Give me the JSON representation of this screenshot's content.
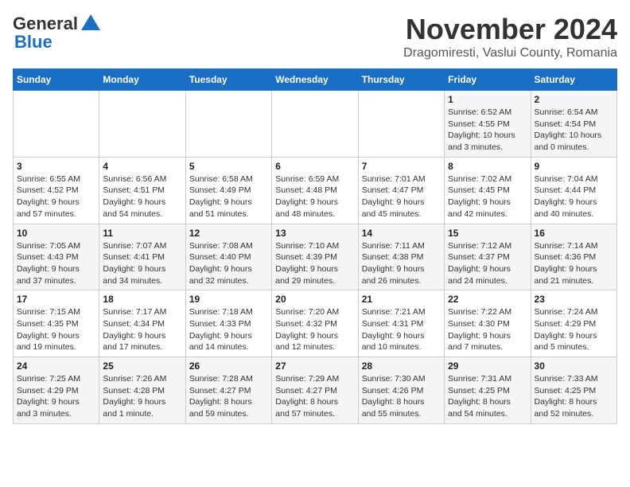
{
  "header": {
    "logo_line1": "General",
    "logo_line2": "Blue",
    "title": "November 2024",
    "subtitle": "Dragomiresti, Vaslui County, Romania"
  },
  "calendar": {
    "days_of_week": [
      "Sunday",
      "Monday",
      "Tuesday",
      "Wednesday",
      "Thursday",
      "Friday",
      "Saturday"
    ],
    "weeks": [
      [
        {
          "day": "",
          "info": ""
        },
        {
          "day": "",
          "info": ""
        },
        {
          "day": "",
          "info": ""
        },
        {
          "day": "",
          "info": ""
        },
        {
          "day": "",
          "info": ""
        },
        {
          "day": "1",
          "info": "Sunrise: 6:52 AM\nSunset: 4:55 PM\nDaylight: 10 hours\nand 3 minutes."
        },
        {
          "day": "2",
          "info": "Sunrise: 6:54 AM\nSunset: 4:54 PM\nDaylight: 10 hours\nand 0 minutes."
        }
      ],
      [
        {
          "day": "3",
          "info": "Sunrise: 6:55 AM\nSunset: 4:52 PM\nDaylight: 9 hours\nand 57 minutes."
        },
        {
          "day": "4",
          "info": "Sunrise: 6:56 AM\nSunset: 4:51 PM\nDaylight: 9 hours\nand 54 minutes."
        },
        {
          "day": "5",
          "info": "Sunrise: 6:58 AM\nSunset: 4:49 PM\nDaylight: 9 hours\nand 51 minutes."
        },
        {
          "day": "6",
          "info": "Sunrise: 6:59 AM\nSunset: 4:48 PM\nDaylight: 9 hours\nand 48 minutes."
        },
        {
          "day": "7",
          "info": "Sunrise: 7:01 AM\nSunset: 4:47 PM\nDaylight: 9 hours\nand 45 minutes."
        },
        {
          "day": "8",
          "info": "Sunrise: 7:02 AM\nSunset: 4:45 PM\nDaylight: 9 hours\nand 42 minutes."
        },
        {
          "day": "9",
          "info": "Sunrise: 7:04 AM\nSunset: 4:44 PM\nDaylight: 9 hours\nand 40 minutes."
        }
      ],
      [
        {
          "day": "10",
          "info": "Sunrise: 7:05 AM\nSunset: 4:43 PM\nDaylight: 9 hours\nand 37 minutes."
        },
        {
          "day": "11",
          "info": "Sunrise: 7:07 AM\nSunset: 4:41 PM\nDaylight: 9 hours\nand 34 minutes."
        },
        {
          "day": "12",
          "info": "Sunrise: 7:08 AM\nSunset: 4:40 PM\nDaylight: 9 hours\nand 32 minutes."
        },
        {
          "day": "13",
          "info": "Sunrise: 7:10 AM\nSunset: 4:39 PM\nDaylight: 9 hours\nand 29 minutes."
        },
        {
          "day": "14",
          "info": "Sunrise: 7:11 AM\nSunset: 4:38 PM\nDaylight: 9 hours\nand 26 minutes."
        },
        {
          "day": "15",
          "info": "Sunrise: 7:12 AM\nSunset: 4:37 PM\nDaylight: 9 hours\nand 24 minutes."
        },
        {
          "day": "16",
          "info": "Sunrise: 7:14 AM\nSunset: 4:36 PM\nDaylight: 9 hours\nand 21 minutes."
        }
      ],
      [
        {
          "day": "17",
          "info": "Sunrise: 7:15 AM\nSunset: 4:35 PM\nDaylight: 9 hours\nand 19 minutes."
        },
        {
          "day": "18",
          "info": "Sunrise: 7:17 AM\nSunset: 4:34 PM\nDaylight: 9 hours\nand 17 minutes."
        },
        {
          "day": "19",
          "info": "Sunrise: 7:18 AM\nSunset: 4:33 PM\nDaylight: 9 hours\nand 14 minutes."
        },
        {
          "day": "20",
          "info": "Sunrise: 7:20 AM\nSunset: 4:32 PM\nDaylight: 9 hours\nand 12 minutes."
        },
        {
          "day": "21",
          "info": "Sunrise: 7:21 AM\nSunset: 4:31 PM\nDaylight: 9 hours\nand 10 minutes."
        },
        {
          "day": "22",
          "info": "Sunrise: 7:22 AM\nSunset: 4:30 PM\nDaylight: 9 hours\nand 7 minutes."
        },
        {
          "day": "23",
          "info": "Sunrise: 7:24 AM\nSunset: 4:29 PM\nDaylight: 9 hours\nand 5 minutes."
        }
      ],
      [
        {
          "day": "24",
          "info": "Sunrise: 7:25 AM\nSunset: 4:29 PM\nDaylight: 9 hours\nand 3 minutes."
        },
        {
          "day": "25",
          "info": "Sunrise: 7:26 AM\nSunset: 4:28 PM\nDaylight: 9 hours\nand 1 minute."
        },
        {
          "day": "26",
          "info": "Sunrise: 7:28 AM\nSunset: 4:27 PM\nDaylight: 8 hours\nand 59 minutes."
        },
        {
          "day": "27",
          "info": "Sunrise: 7:29 AM\nSunset: 4:27 PM\nDaylight: 8 hours\nand 57 minutes."
        },
        {
          "day": "28",
          "info": "Sunrise: 7:30 AM\nSunset: 4:26 PM\nDaylight: 8 hours\nand 55 minutes."
        },
        {
          "day": "29",
          "info": "Sunrise: 7:31 AM\nSunset: 4:25 PM\nDaylight: 8 hours\nand 54 minutes."
        },
        {
          "day": "30",
          "info": "Sunrise: 7:33 AM\nSunset: 4:25 PM\nDaylight: 8 hours\nand 52 minutes."
        }
      ]
    ]
  }
}
